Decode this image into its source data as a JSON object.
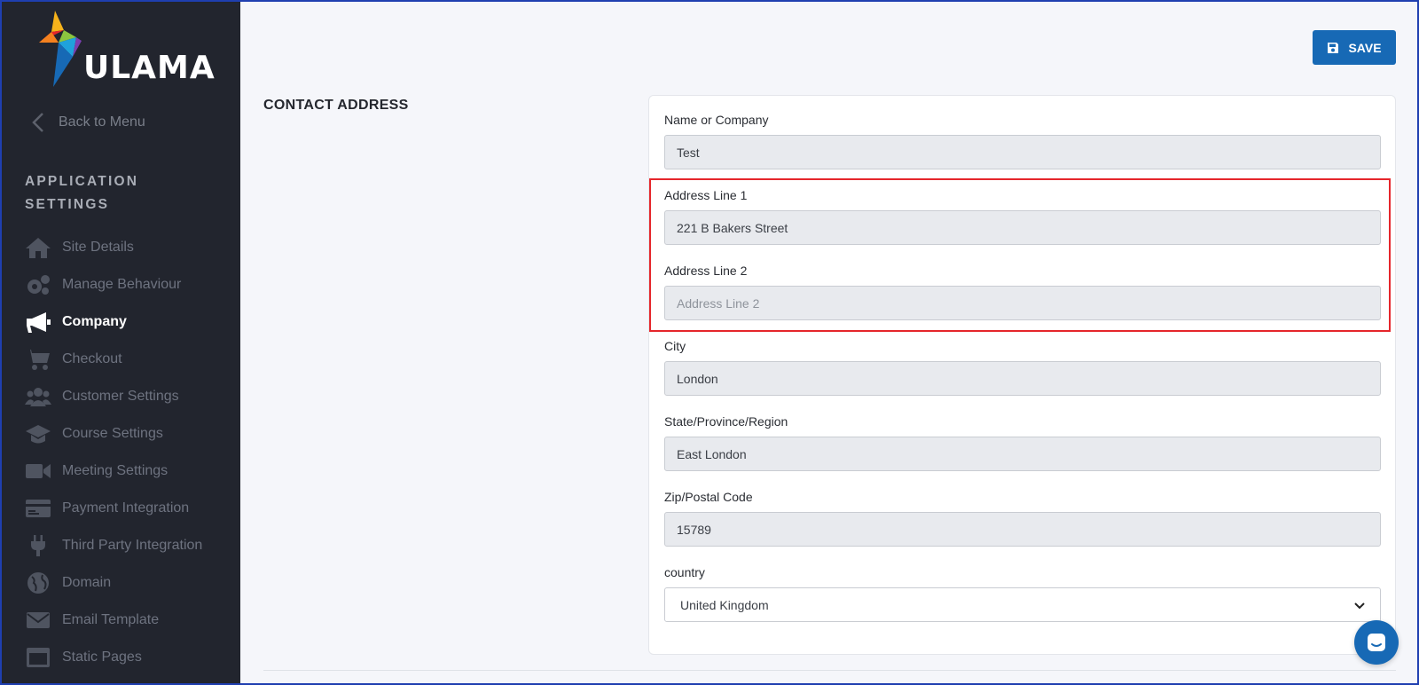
{
  "brand": {
    "name": "ULAMA"
  },
  "sidebar": {
    "back_label": "Back to Menu",
    "section_title": "APPLICATION SETTINGS",
    "items": [
      {
        "label": "Site Details",
        "icon": "home-icon",
        "active": false
      },
      {
        "label": "Manage Behaviour",
        "icon": "gears-icon",
        "active": false
      },
      {
        "label": "Company",
        "icon": "megaphone-icon",
        "active": true
      },
      {
        "label": "Checkout",
        "icon": "cart-icon",
        "active": false
      },
      {
        "label": "Customer Settings",
        "icon": "users-icon",
        "active": false
      },
      {
        "label": "Course Settings",
        "icon": "graduation-cap-icon",
        "active": false
      },
      {
        "label": "Meeting Settings",
        "icon": "video-camera-icon",
        "active": false
      },
      {
        "label": "Payment Integration",
        "icon": "credit-card-icon",
        "active": false
      },
      {
        "label": "Third Party Integration",
        "icon": "plug-icon",
        "active": false
      },
      {
        "label": "Domain",
        "icon": "globe-icon",
        "active": false
      },
      {
        "label": "Email Template",
        "icon": "envelope-icon",
        "active": false
      },
      {
        "label": "Static Pages",
        "icon": "window-icon",
        "active": false
      }
    ]
  },
  "toolbar": {
    "save_label": "SAVE"
  },
  "main": {
    "section_title": "CONTACT ADDRESS",
    "fields": {
      "name": {
        "label": "Name or Company",
        "value": "Test"
      },
      "address1": {
        "label": "Address Line 1",
        "value": "221 B Bakers Street"
      },
      "address2": {
        "label": "Address Line 2",
        "value": "",
        "placeholder": "Address Line 2"
      },
      "city": {
        "label": "City",
        "value": "London"
      },
      "state": {
        "label": "State/Province/Region",
        "value": "East London"
      },
      "zip": {
        "label": "Zip/Postal Code",
        "value": "15789"
      },
      "country": {
        "label": "country",
        "value": "United Kingdom"
      }
    }
  },
  "colors": {
    "sidebar_bg": "#22252e",
    "accent": "#1769b5",
    "highlight": "#e5262b"
  }
}
